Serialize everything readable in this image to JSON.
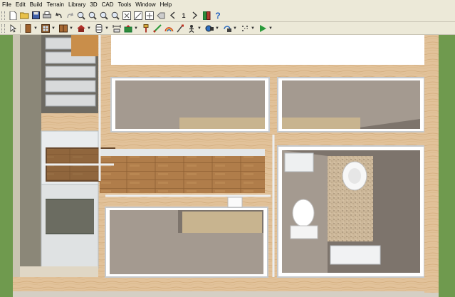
{
  "menu": {
    "items": [
      "File",
      "Edit",
      "Build",
      "Terrain",
      "Library",
      "3D",
      "CAD",
      "Tools",
      "Window",
      "Help"
    ]
  },
  "toolbar1": {
    "icons": [
      "new-file-icon",
      "open-folder-icon",
      "save-icon",
      "print-icon",
      "undo-icon",
      "redo-icon",
      "zoom-in-icon",
      "zoom-out-icon",
      "zoom-window-icon",
      "zoom-fit-icon",
      "fill-window-icon",
      "pan-icon",
      "swap-view-icon",
      "toggle-icon",
      "previous-icon",
      "info-icon",
      "next-icon",
      "library-icon",
      "help-icon"
    ],
    "info_glyph": "1",
    "help_glyph": "?"
  },
  "toolbar2": {
    "icons": [
      "select-arrow-icon",
      "door-icon",
      "window-icon",
      "cabinet-icon",
      "roof-icon",
      "stair-icon",
      "dimension-icon",
      "camera-icon",
      "paint-icon",
      "material-icon",
      "eyedropper-icon",
      "elevation-camera-icon",
      "walkthrough-icon",
      "orbit-icon",
      "transform-icon",
      "play-icon"
    ]
  },
  "colors": {
    "wood_floor": "#b07d4a",
    "wall_cap": "#e2c29a",
    "room_floor": "#7d746c",
    "grass": "#6f9a4e",
    "carpet": "#c8b48f"
  }
}
